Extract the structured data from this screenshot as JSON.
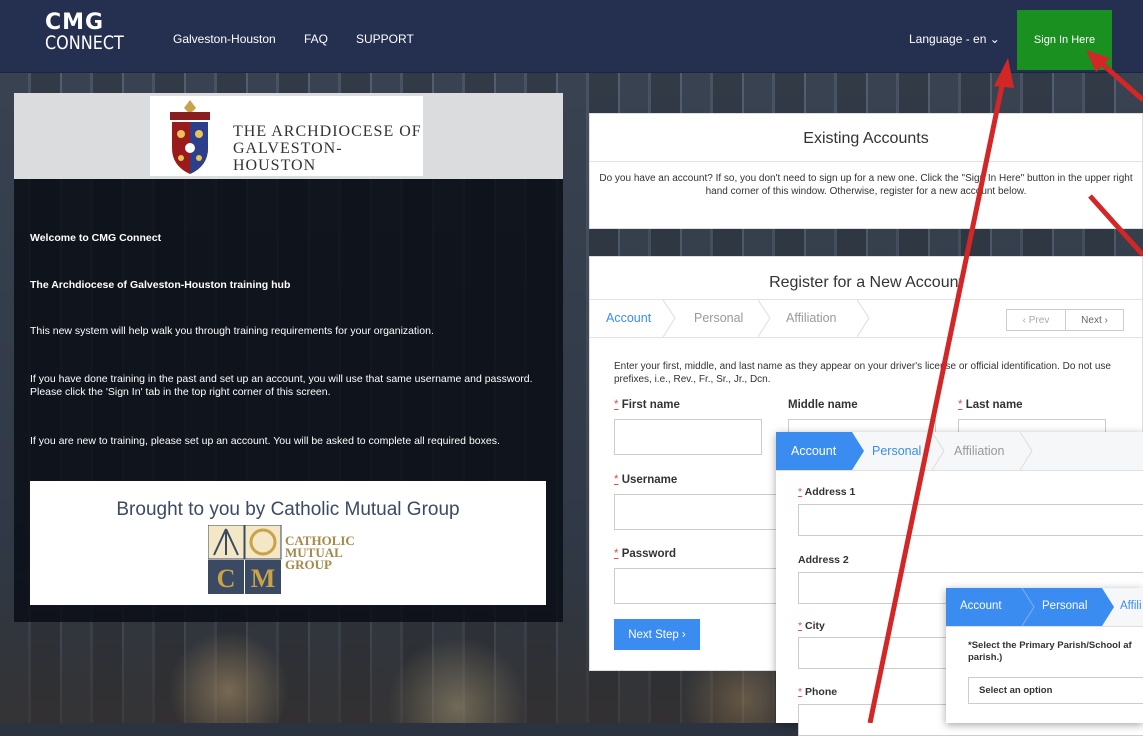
{
  "nav": {
    "logo_line1": "CMG",
    "logo_line2": "CONNECT",
    "items": [
      "Galveston-Houston",
      "FAQ",
      "SUPPORT"
    ],
    "language": "Language - en",
    "sign_in": "Sign In Here"
  },
  "left": {
    "arch_line1": "THE ARCHDIOCESE OF",
    "arch_line2": "GALVESTON-HOUSTON",
    "welcome": "Welcome to CMG Connect",
    "hub": "The Archdiocese of Galveston-Houston training hub",
    "p1": "This new system will help walk you through training requirements for your organization.",
    "p2": "If you have done training in the past and set up an account, you will use that same username and password.  Please click the 'Sign In' tab in the top right corner of this screen.",
    "p3": "If you are new to training, please set up an account.  You will be asked to complete all required boxes.",
    "brought": "Brought to you by Catholic Mutual Group",
    "cm_line1": "CATHOLIC",
    "cm_line2": "MUTUAL",
    "cm_line3": "GROUP"
  },
  "existing": {
    "title": "Existing Accounts",
    "text": "Do you have an account? If so, you don't need to sign up for a new one. Click the \"Sign In Here\" button in the upper right hand corner of this window. Otherwise, register for a new account below."
  },
  "register": {
    "title": "Register for a New Account",
    "tabs": [
      "Account",
      "Personal",
      "Affiliation"
    ],
    "prev": "Prev",
    "next": "Next",
    "instructions": "Enter your first, middle, and last name as they appear on your driver's license or official identification. Do not use prefixes, i.e., Rev., Fr., Sr., Jr., Dcn.",
    "first_name": "First name",
    "middle_name": "Middle name",
    "last_name": "Last name",
    "username": "Username",
    "password": "Password",
    "next_step": "Next Step"
  },
  "personal": {
    "tabs": [
      "Account",
      "Personal",
      "Affiliation"
    ],
    "address1": "Address 1",
    "address2": "Address 2",
    "city": "City",
    "phone": "Phone"
  },
  "affiliation": {
    "tabs": [
      "Account",
      "Personal",
      "Affili"
    ],
    "select_label_1": "*Select the Primary Parish/School af",
    "select_label_2": "parish.)",
    "select_value": "Select an option"
  },
  "colors": {
    "nav_bg": "#253050",
    "sign_in_bg": "#1a9020",
    "accent_blue": "#3b8cf0",
    "required_red": "#d9534f",
    "arrow_red": "#d32626"
  }
}
